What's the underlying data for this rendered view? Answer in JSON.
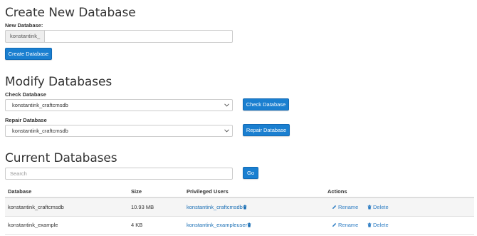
{
  "create": {
    "title": "Create New Database",
    "label": "New Database:",
    "prefix": "konstantink_",
    "value": "",
    "button": "Create Database"
  },
  "modify": {
    "title": "Modify Databases",
    "check_label": "Check Database",
    "check_selected": "konstantink_craftcmsdb",
    "check_button": "Check Database",
    "repair_label": "Repair Database",
    "repair_selected": "konstantink_craftcmsdb",
    "repair_button": "Repair Database"
  },
  "current": {
    "title": "Current Databases",
    "search_placeholder": "Search",
    "go_button": "Go",
    "columns": [
      "Database",
      "Size",
      "Privileged Users",
      "Actions"
    ],
    "rows": [
      {
        "database": "konstantink_craftcmsdb",
        "size": "10.93 MB",
        "user": "konstantink_craftcmsdb",
        "rename": "Rename",
        "delete": "Delete"
      },
      {
        "database": "konstantink_example",
        "size": "4 KB",
        "user": "konstantink_exampleuser",
        "rename": "Rename",
        "delete": "Delete"
      }
    ]
  },
  "icons": {
    "select_chevron": "chevron-down-icon",
    "remove_user": "trash-icon",
    "rename": "pencil-icon",
    "delete": "trash-icon"
  },
  "colors": {
    "primary_button": "#1a7fd0",
    "link": "#1a6fb5",
    "action_link": "#2f7ec4"
  }
}
